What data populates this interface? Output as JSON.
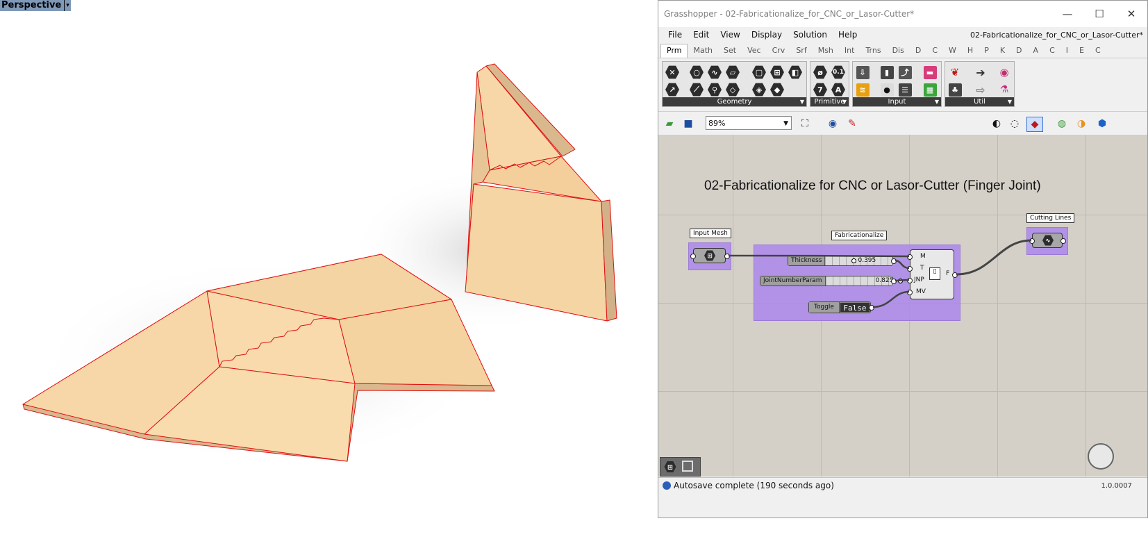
{
  "viewport": {
    "label": "Perspective"
  },
  "window": {
    "title": "Grasshopper - 02-Fabricationalize_for_CNC_or_Lasor-Cutter*",
    "buttons": {
      "minimize": "—",
      "maximize": "☐",
      "close": "✕"
    }
  },
  "menu": {
    "items": [
      "File",
      "Edit",
      "View",
      "Display",
      "Solution",
      "Help"
    ],
    "document": "02-Fabricationalize_for_CNC_or_Lasor-Cutter*"
  },
  "tabs": [
    "Prm",
    "Math",
    "Set",
    "Vec",
    "Crv",
    "Srf",
    "Msh",
    "Int",
    "Trns",
    "Dis",
    "D",
    "C",
    "W",
    "H",
    "P",
    "K",
    "D",
    "A",
    "C",
    "I",
    "E",
    "C"
  ],
  "ribbon": {
    "panels": [
      "Geometry",
      "Primitive",
      "Input",
      "Util"
    ],
    "primitive_icons": [
      "0.1",
      "7",
      "A"
    ]
  },
  "toolbar": {
    "zoom": "89%"
  },
  "canvas": {
    "title": "02-Fabricationalize for CNC or Lasor-Cutter (Finger Joint)",
    "groups": {
      "input": "Input Mesh",
      "main": "Fabricationalize",
      "output": "Cutting Lines"
    },
    "sliders": [
      {
        "name": "Thickness",
        "value": "0.395"
      },
      {
        "name": "JointNumberParam",
        "value": "0.825"
      }
    ],
    "toggle": {
      "name": "Toggle",
      "value": "False"
    },
    "component": {
      "inputs": [
        "M",
        "T",
        "JNP",
        "MV"
      ],
      "output": "F"
    }
  },
  "status": {
    "message": "Autosave complete (190 seconds ago)",
    "version": "1.0.0007"
  },
  "colors": {
    "group_fill": "#aa87eb",
    "canvas_bg": "#d4d0c8",
    "panel_fill": "#f7d7a8",
    "panel_edge": "#e01010"
  }
}
